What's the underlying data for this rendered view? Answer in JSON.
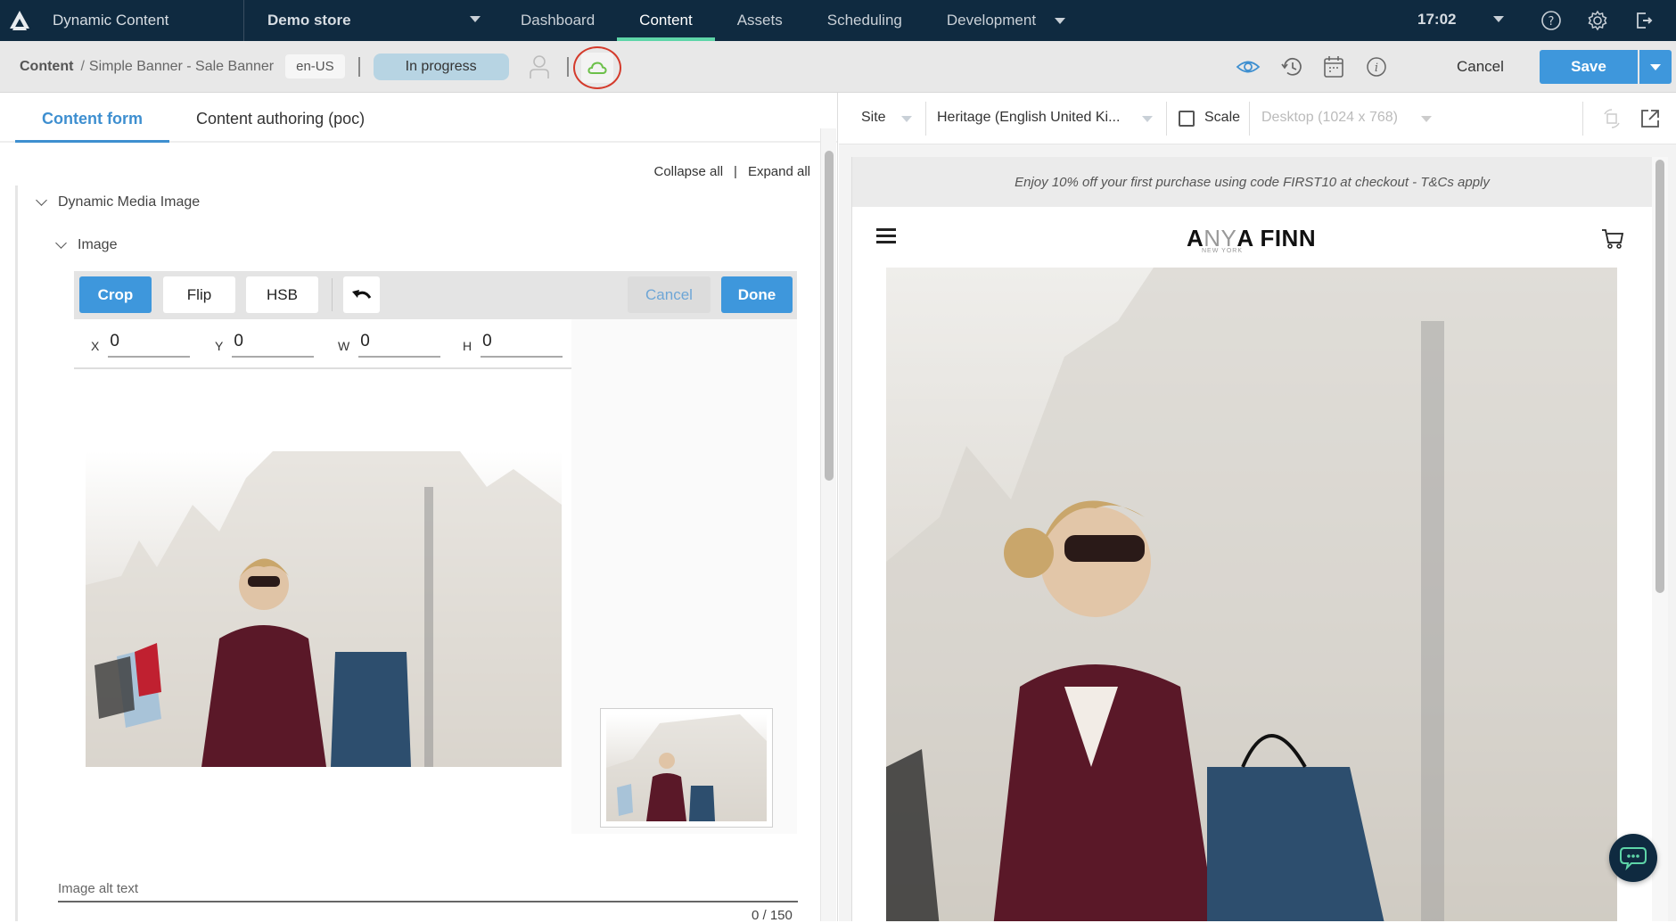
{
  "app": {
    "title": "Dynamic Content",
    "store": "Demo store",
    "nav": [
      {
        "label": "Dashboard",
        "active": false
      },
      {
        "label": "Content",
        "active": true
      },
      {
        "label": "Assets",
        "active": false
      },
      {
        "label": "Scheduling",
        "active": false
      },
      {
        "label": "Development",
        "active": false
      }
    ],
    "time": "17:02",
    "icons": [
      "help-icon",
      "gear-icon",
      "logout-icon"
    ]
  },
  "subheader": {
    "breadcrumb_root": "Content",
    "breadcrumb_sep": "/",
    "breadcrumb_item": "Simple Banner - Sale Banner",
    "locale": "en-US",
    "status": "In progress",
    "cloud_color": "#6cc04a",
    "icons": [
      "preview-eye-icon",
      "history-icon",
      "calendar-icon",
      "info-icon"
    ],
    "cancel_label": "Cancel",
    "save_label": "Save"
  },
  "left": {
    "tabs": [
      {
        "label": "Content form",
        "active": true
      },
      {
        "label": "Content authoring (poc)",
        "active": false
      }
    ],
    "collapse_all": "Collapse all",
    "separator": "|",
    "expand_all": "Expand all",
    "section_title": "Dynamic Media Image",
    "subsection_title": "Image",
    "editor": {
      "tools": [
        "Crop",
        "Flip",
        "HSB"
      ],
      "active_tool": "Crop",
      "cancel_label": "Cancel",
      "done_label": "Done",
      "coords": [
        {
          "label": "X",
          "value": "0"
        },
        {
          "label": "Y",
          "value": "0"
        },
        {
          "label": "W",
          "value": "0"
        },
        {
          "label": "H",
          "value": "0"
        }
      ]
    },
    "alt_text": {
      "placeholder": "Image alt text",
      "value": "",
      "counter": "0 / 150"
    }
  },
  "preview": {
    "site_label": "Site",
    "locale_select": "Heritage (English United Ki...",
    "scale_label": "Scale",
    "scale_checked": false,
    "device_select": "Desktop (1024 x 768)",
    "promo_text": "Enjoy 10% off your first purchase using code FIRST10 at checkout - T&Cs apply",
    "brand_logo_a": "A",
    "brand_logo_ny": "NY",
    "brand_logo_rest": "A FINN",
    "brand_logo_sub": "NEW YORK"
  },
  "colors": {
    "nav_bg": "#0f2a40",
    "nav_active_underline": "#5ed5a8",
    "primary": "#3e97dc",
    "status_bg": "#b7d4e3"
  }
}
